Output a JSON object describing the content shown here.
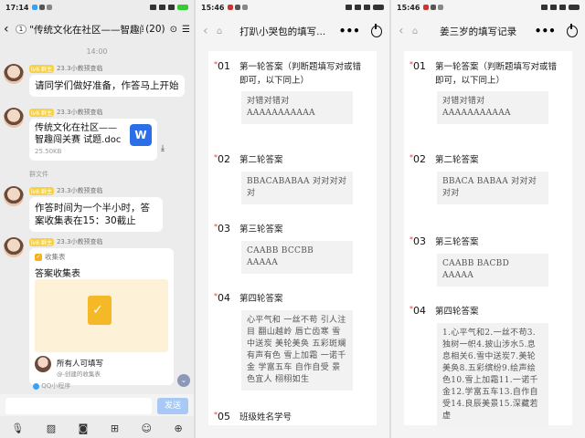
{
  "chat": {
    "status_time": "17:14",
    "back_badge": "1",
    "title": "\"传统文化在社区——智趣闯关...",
    "member_count": "(20)",
    "time_divider": "14:00",
    "sender": "23.3小教预查临",
    "level_badge": "lv6 群主",
    "messages": [
      {
        "text": "请同学们做好准备，作答马上开始"
      },
      {
        "file_name": "传统文化在社区——智趣闯关赛 试题.doc",
        "file_size": "25.50KB",
        "file_icon": "W"
      },
      {
        "text": "作答时间为一个半小时，答案收集表在15：30截止"
      }
    ],
    "system_note": "群文件",
    "card": {
      "tag": "收集表",
      "heading": "答案收集表",
      "title": "所有人可填写",
      "subtitle": "@-创建的收集表"
    },
    "qq_label": "QQ小程序",
    "send_label": "发送",
    "tools": [
      "mic-icon",
      "image-icon",
      "camera-icon",
      "gift-icon",
      "emoji-icon",
      "plus-icon"
    ]
  },
  "form1": {
    "status_time": "15:46",
    "title": "打趴小哭包的填写...",
    "questions": [
      {
        "num": "01",
        "label": "第一轮答案（判断题填写对或错即可，以下同上）",
        "answer": "对错对错对 AAAAAAAAAAA"
      },
      {
        "num": "02",
        "label": "第二轮答案",
        "answer": "BBACABABAA 对对对对对"
      },
      {
        "num": "03",
        "label": "第三轮答案",
        "answer": "CAABB BCCBB AAAAA"
      },
      {
        "num": "04",
        "label": "第四轮答案",
        "answer": "心平气和 一丝不苟 引人注目 翻山越岭 唇亡齿寒 雪中送炭 美轮美奂 五彩斑斓 有声有色 雪上加霜 一诺千金 学富五车 自作自受 景色宜人 栩栩如生"
      },
      {
        "num": "05",
        "label": "班级姓名学号"
      }
    ]
  },
  "form2": {
    "status_time": "15:46",
    "title": "姜三岁的填写记录",
    "questions": [
      {
        "num": "01",
        "label": "第一轮答案（判断题填写对或错即可，以下同上）",
        "answer": "对错对错对 AAAAAAAAAAA"
      },
      {
        "num": "02",
        "label": "第二轮答案",
        "answer": "BBACA BABAA 对对对对对"
      },
      {
        "num": "03",
        "label": "第三轮答案",
        "answer": "CAABB BACBD AAAAA"
      },
      {
        "num": "04",
        "label": "第四轮答案",
        "answer": "1.心平气和2.一丝不苟3.独树一帜4.披山涉水5.息息相关6.雪中送炭7.美轮美奂8.五彩缤纷9.绘声绘色10.雪上加霜11.一诺千金12.学富五车13.自作自受14.良辰美景15.深藏若虚"
      }
    ]
  },
  "colors": {
    "accent": "#2b6ee8",
    "star": "#e33333",
    "send": "#a8c8f5",
    "card_yellow": "#f5b826"
  }
}
